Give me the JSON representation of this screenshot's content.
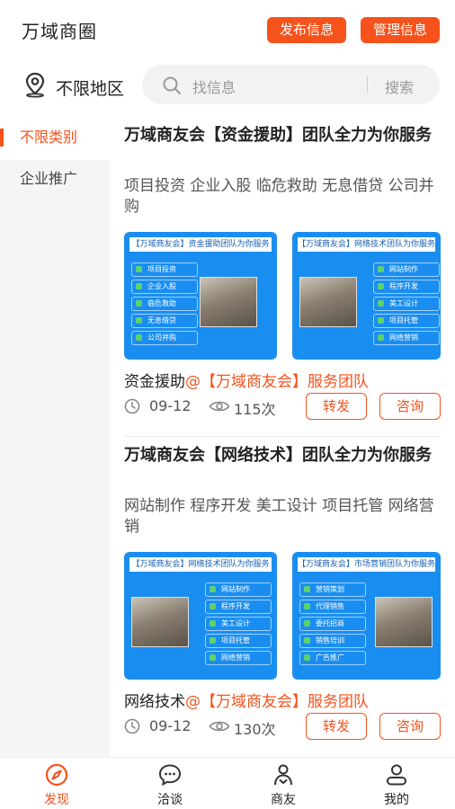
{
  "header": {
    "title": "万域商圈",
    "publish_label": "发布信息",
    "manage_label": "管理信息"
  },
  "search": {
    "location_label": "不限地区",
    "placeholder": "找信息",
    "button_label": "搜索"
  },
  "sidebar": {
    "items": [
      {
        "label": "不限类别",
        "active": true
      },
      {
        "label": "企业推广",
        "active": false
      }
    ]
  },
  "posts": [
    {
      "title": "万域商友会【资金援助】团队全力为你服务",
      "desc": "项目投资 企业入股 临危救助 无息借贷 公司并购",
      "img_a": {
        "header": "【万域商友会】资金援助团队为你服务",
        "items": [
          "项目投资",
          "企业入股",
          "临危救助",
          "无息借贷",
          "公司并购"
        ]
      },
      "img_b": {
        "header": "【万域商友会】网络技术团队为你服务",
        "items": [
          "网站制作",
          "程序开发",
          "美工设计",
          "项目托管",
          "网络营销"
        ]
      },
      "source_prefix": "资金援助",
      "source_suffix": "@【万域商友会】服务团队",
      "date": "09-12",
      "views": "115次",
      "forward_label": "转发",
      "consult_label": "咨询"
    },
    {
      "title": "万域商友会【网络技术】团队全力为你服务",
      "desc": "网站制作 程序开发 美工设计 项目托管 网络营销",
      "img_a": {
        "header": "【万域商友会】网络技术团队为你服务",
        "items": [
          "网站制作",
          "程序开发",
          "美工设计",
          "项目托管",
          "网络营销"
        ]
      },
      "img_b": {
        "header": "【万域商友会】市场营销团队为你服务",
        "items": [
          "营销策划",
          "代理销售",
          "委托招商",
          "销售培训",
          "广告推广"
        ]
      },
      "source_prefix": "网络技术",
      "source_suffix": "@【万域商友会】服务团队",
      "date": "09-12",
      "views": "130次",
      "forward_label": "转发",
      "consult_label": "咨询"
    }
  ],
  "tabbar": {
    "items": [
      {
        "label": "发现",
        "icon": "compass-icon",
        "active": true
      },
      {
        "label": "洽谈",
        "icon": "chat-icon",
        "active": false
      },
      {
        "label": "商友",
        "icon": "friends-icon",
        "active": false
      },
      {
        "label": "我的",
        "icon": "profile-icon",
        "active": false
      }
    ]
  },
  "colors": {
    "accent": "#f5521c",
    "image_blue": "#1a8ef0"
  }
}
